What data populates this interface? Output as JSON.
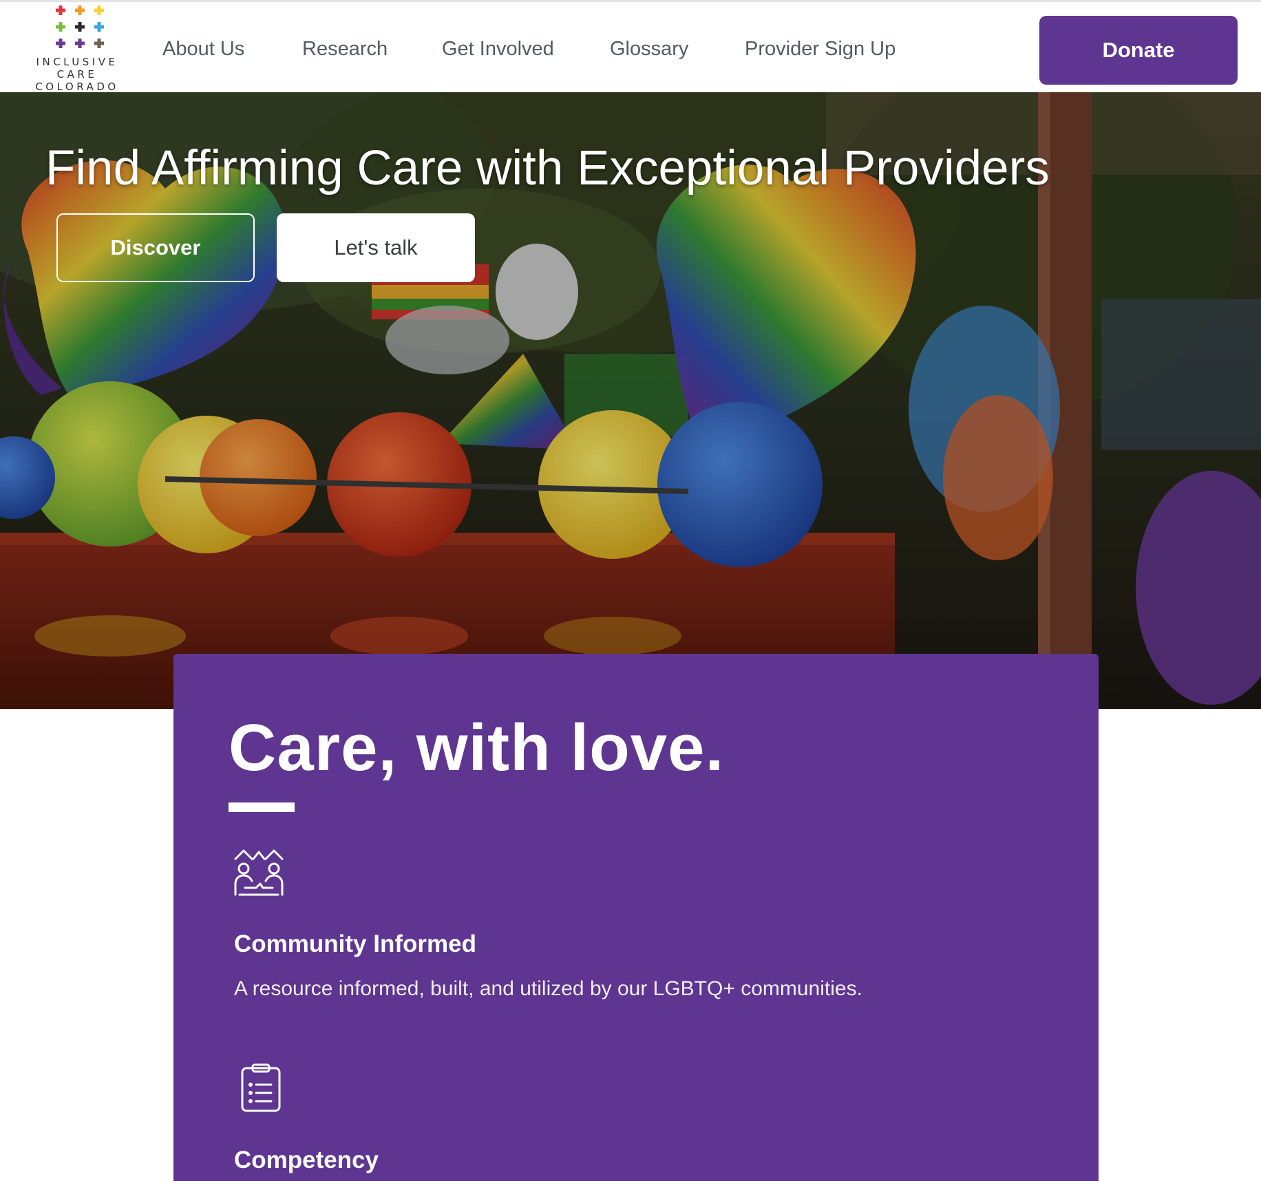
{
  "header": {
    "logo": {
      "line1": "INCLUSIVE",
      "line2": "CARE",
      "line3": "COLORADO",
      "cross_colors": [
        "#e2363c",
        "#f39a2b",
        "#f7d23a",
        "#7dbb42",
        "#2b2b2b",
        "#3aa6dd",
        "#6a3a96",
        "#6a3a96",
        "#6b6255"
      ]
    },
    "nav": {
      "about": "About Us",
      "research": "Research",
      "involved": "Get Involved",
      "glossary": "Glossary",
      "provider": "Provider Sign Up"
    },
    "donate_label": "Donate"
  },
  "hero": {
    "title": "Find Affirming Care with Exceptional Providers",
    "discover_label": "Discover",
    "talk_label": "Let's talk",
    "photo_subject": "rainbow pride balloons"
  },
  "card": {
    "heading": "Care, with love.",
    "features": [
      {
        "icon": "community-people-icon",
        "title": "Community Informed",
        "description": "A resource informed, built, and utilized by our LGBTQ+ communities."
      },
      {
        "icon": "clipboard-list-icon",
        "title": "Competency"
      }
    ]
  },
  "colors": {
    "brand_purple": "#5e3590",
    "nav_text": "#555a60",
    "white": "#ffffff"
  }
}
